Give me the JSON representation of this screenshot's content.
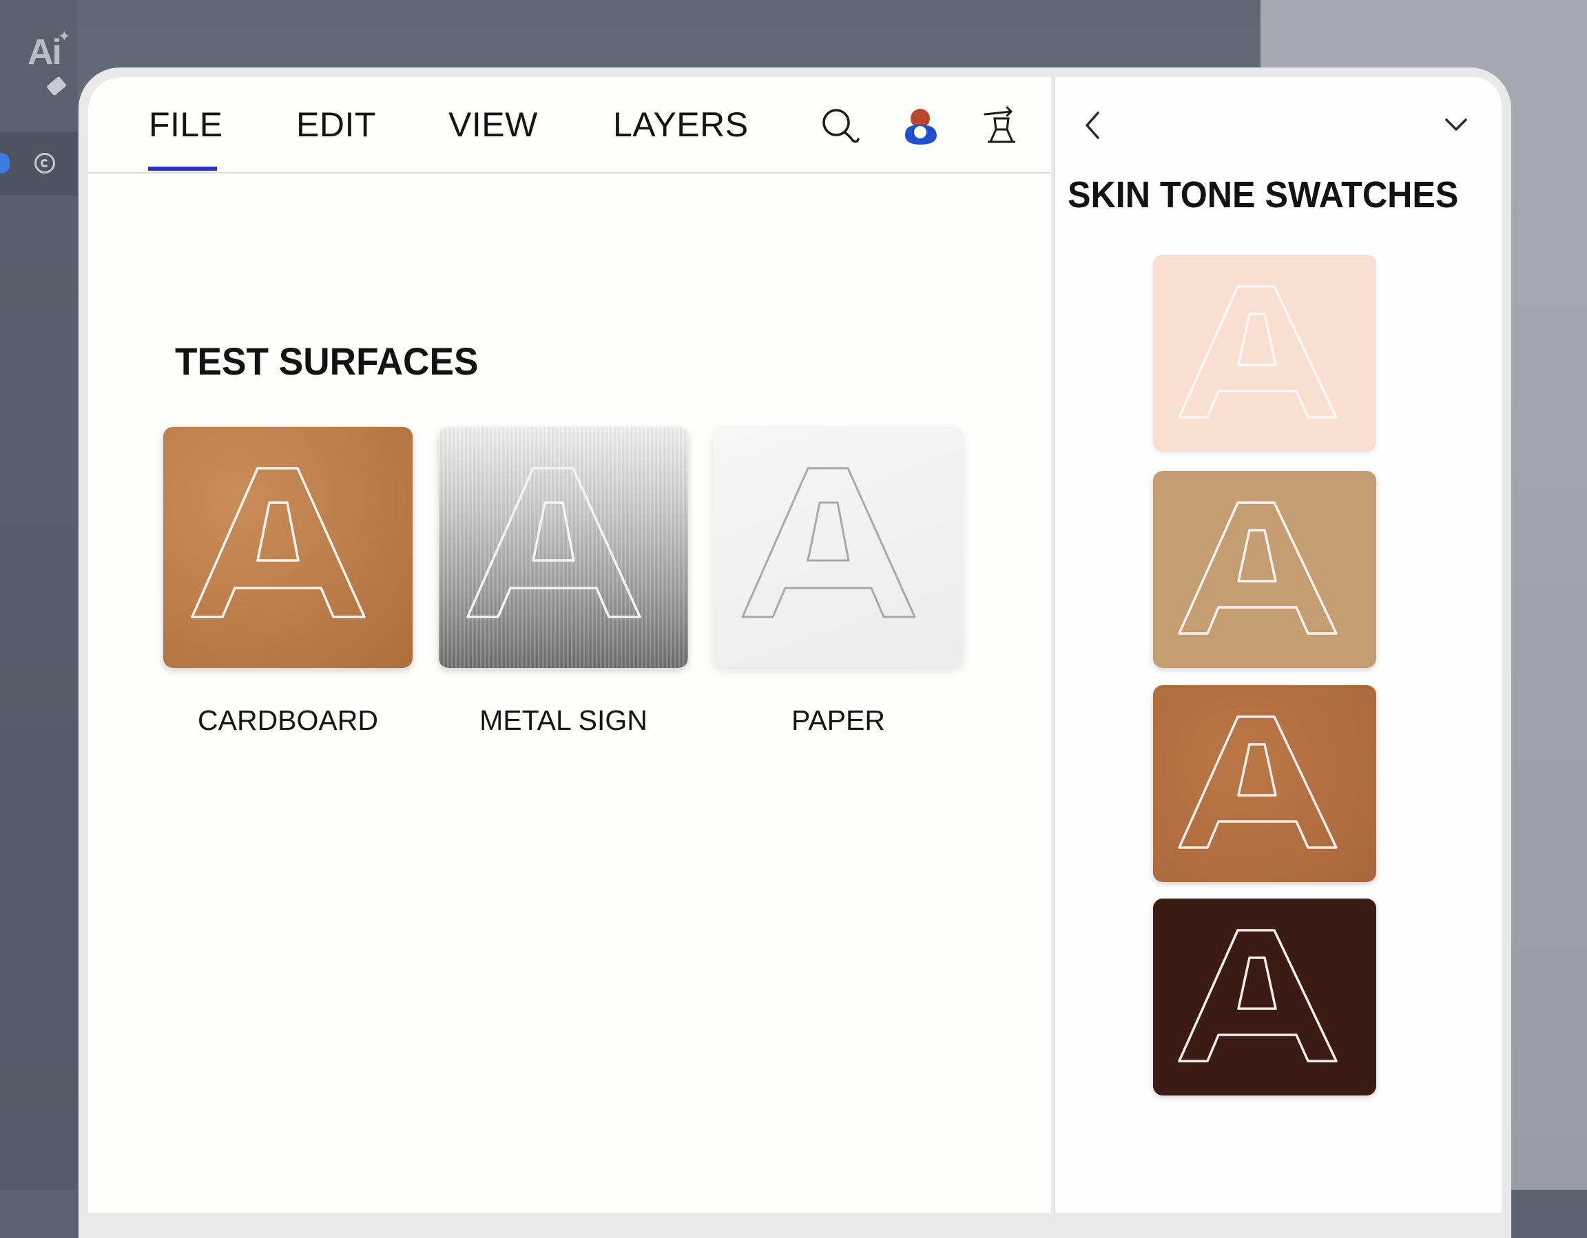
{
  "app": {
    "logo_text": "Ai"
  },
  "menu": {
    "items": [
      {
        "label": "FILE",
        "active": true
      },
      {
        "label": "EDIT"
      },
      {
        "label": "VIEW"
      },
      {
        "label": "LAYERS"
      }
    ],
    "icons": [
      "search-icon",
      "user-icon",
      "stamp-icon"
    ],
    "accent": "#2b35c9"
  },
  "canvas": {
    "section_title": "TEST SURFACES",
    "tiles": [
      {
        "label": "CARDBOARD",
        "letter": "A",
        "color": "#b97a47"
      },
      {
        "label": "METAL SIGN",
        "letter": "A",
        "color": "#a0a0a0"
      },
      {
        "label": "PAPER",
        "letter": "A",
        "color": "#f2f2f2"
      }
    ]
  },
  "side_panel": {
    "title": "SKIN TONE SWATCHES",
    "icons": [
      "chevron-left-icon",
      "chevron-down-icon"
    ],
    "swatches": [
      {
        "letter": "A",
        "color": "#f9dfd0"
      },
      {
        "letter": "A",
        "color": "#c59d73"
      },
      {
        "letter": "A",
        "color": "#ad6c3e"
      },
      {
        "letter": "A",
        "color": "#3a1c14"
      }
    ]
  }
}
